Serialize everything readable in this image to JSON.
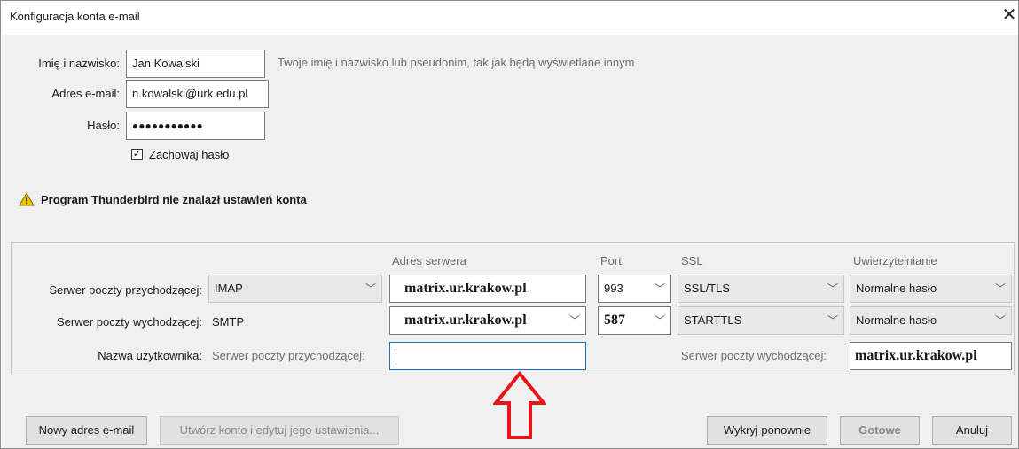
{
  "window": {
    "title": "Konfiguracja konta e-mail",
    "close_glyph": "✕"
  },
  "form": {
    "name_label": "Imię i nazwisko:",
    "name_value": "Jan Kowalski",
    "name_hint": "Twoje imię i nazwisko lub pseudonim, tak jak będą wyświetlane innym",
    "email_label": "Adres e-mail:",
    "email_value": "n.kowalski@urk.edu.pl",
    "password_label": "Hasło:",
    "password_value": "●●●●●●●●●●●",
    "remember_label": "Zachowaj hasło",
    "remember_checked": true
  },
  "warning": {
    "icon": "warning-icon",
    "text": "Program Thunderbird nie znalazł ustawień konta"
  },
  "server": {
    "col_server": "Adres serwera",
    "col_port": "Port",
    "col_ssl": "SSL",
    "col_auth": "Uwierzytelnianie",
    "incoming_label": "Serwer poczty przychodzącej:",
    "incoming_protocol": "IMAP",
    "incoming_host": "matrix.ur.krakow.pl",
    "incoming_port": "993",
    "incoming_ssl": "SSL/TLS",
    "incoming_auth": "Normalne hasło",
    "outgoing_label": "Serwer poczty wychodzącej:",
    "outgoing_protocol": "SMTP",
    "outgoing_host": "matrix.ur.krakow.pl",
    "outgoing_port": "587",
    "outgoing_ssl": "STARTTLS",
    "outgoing_auth": "Normalne hasło",
    "username_label": "Nazwa użytkownika:",
    "username_incoming_label": "Serwer poczty przychodzącej:",
    "username_incoming_value": "",
    "username_outgoing_label": "Serwer poczty wychodzącej:",
    "username_outgoing_value": "matrix.ur.krakow.pl"
  },
  "buttons": {
    "new_email": "Nowy adres e-mail",
    "manual_config": "Utwórz konto i edytuj jego ustawienia...",
    "retest": "Wykryj ponownie",
    "done": "Gotowe",
    "cancel": "Anuluj"
  },
  "colors": {
    "arrow": "#e8141a",
    "focus": "#1e6fbf",
    "warning_fill": "#f2c200"
  }
}
